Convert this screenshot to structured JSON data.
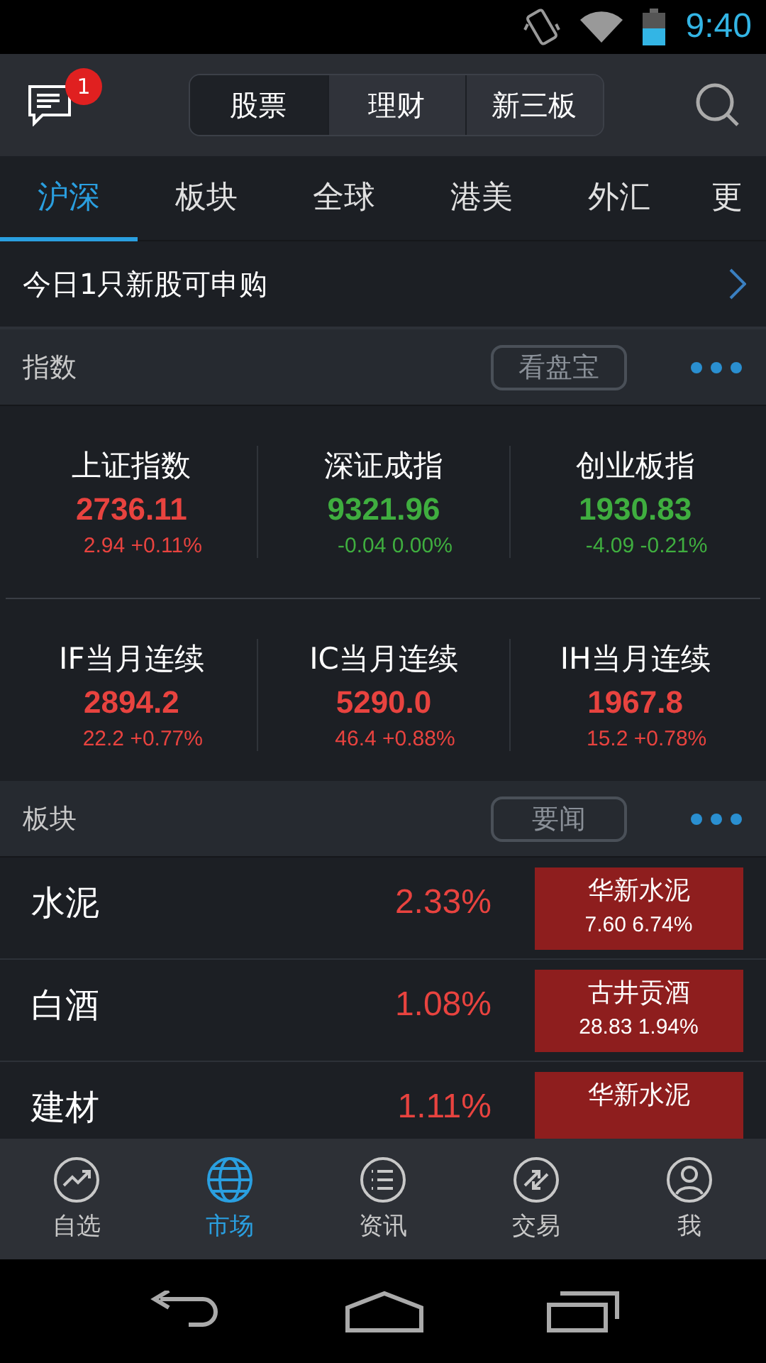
{
  "status_bar": {
    "time": "9:40"
  },
  "header": {
    "badge": "1",
    "segments": [
      {
        "label": "股票",
        "selected": true
      },
      {
        "label": "理财",
        "selected": false
      },
      {
        "label": "新三板",
        "selected": false
      }
    ]
  },
  "tabs": [
    {
      "label": "沪深",
      "selected": true
    },
    {
      "label": "板块",
      "selected": false
    },
    {
      "label": "全球",
      "selected": false
    },
    {
      "label": "港美",
      "selected": false
    },
    {
      "label": "外汇",
      "selected": false
    },
    {
      "label": "更",
      "selected": false
    }
  ],
  "banner": {
    "text": "今日1只新股可申购"
  },
  "index_section": {
    "title": "指数",
    "button": "看盘宝",
    "items": [
      {
        "name": "上证指数",
        "price": "2736.11",
        "change": "2.94 +0.11%",
        "color": "#e8433f"
      },
      {
        "name": "深证成指",
        "price": "9321.96",
        "change": "-0.04 0.00%",
        "color": "#3fae3f"
      },
      {
        "name": "创业板指",
        "price": "1930.83",
        "change": "-4.09 -0.21%",
        "color": "#3fae3f"
      },
      {
        "name": "IF当月连续",
        "price": "2894.2",
        "change": "22.2 +0.77%",
        "color": "#e8433f"
      },
      {
        "name": "IC当月连续",
        "price": "5290.0",
        "change": "46.4 +0.88%",
        "color": "#e8433f"
      },
      {
        "name": "IH当月连续",
        "price": "1967.8",
        "change": "15.2 +0.78%",
        "color": "#e8433f"
      }
    ]
  },
  "sector_section": {
    "title": "板块",
    "button": "要闻",
    "rows": [
      {
        "name": "水泥",
        "change": "2.33%",
        "color": "#e8433f",
        "leader": {
          "name": "华新水泥",
          "quote": "7.60 6.74%"
        }
      },
      {
        "name": "白酒",
        "change": "1.08%",
        "color": "#e8433f",
        "leader": {
          "name": "古井贡酒",
          "quote": "28.83 1.94%"
        }
      },
      {
        "name": "建材",
        "change": "1.11%",
        "color": "#e8433f",
        "leader": {
          "name": "华新水泥"
        }
      }
    ]
  },
  "bottom_nav": [
    {
      "label": "自选",
      "selected": false
    },
    {
      "label": "市场",
      "selected": true
    },
    {
      "label": "资讯",
      "selected": false
    },
    {
      "label": "交易",
      "selected": false
    },
    {
      "label": "我",
      "selected": false
    }
  ]
}
